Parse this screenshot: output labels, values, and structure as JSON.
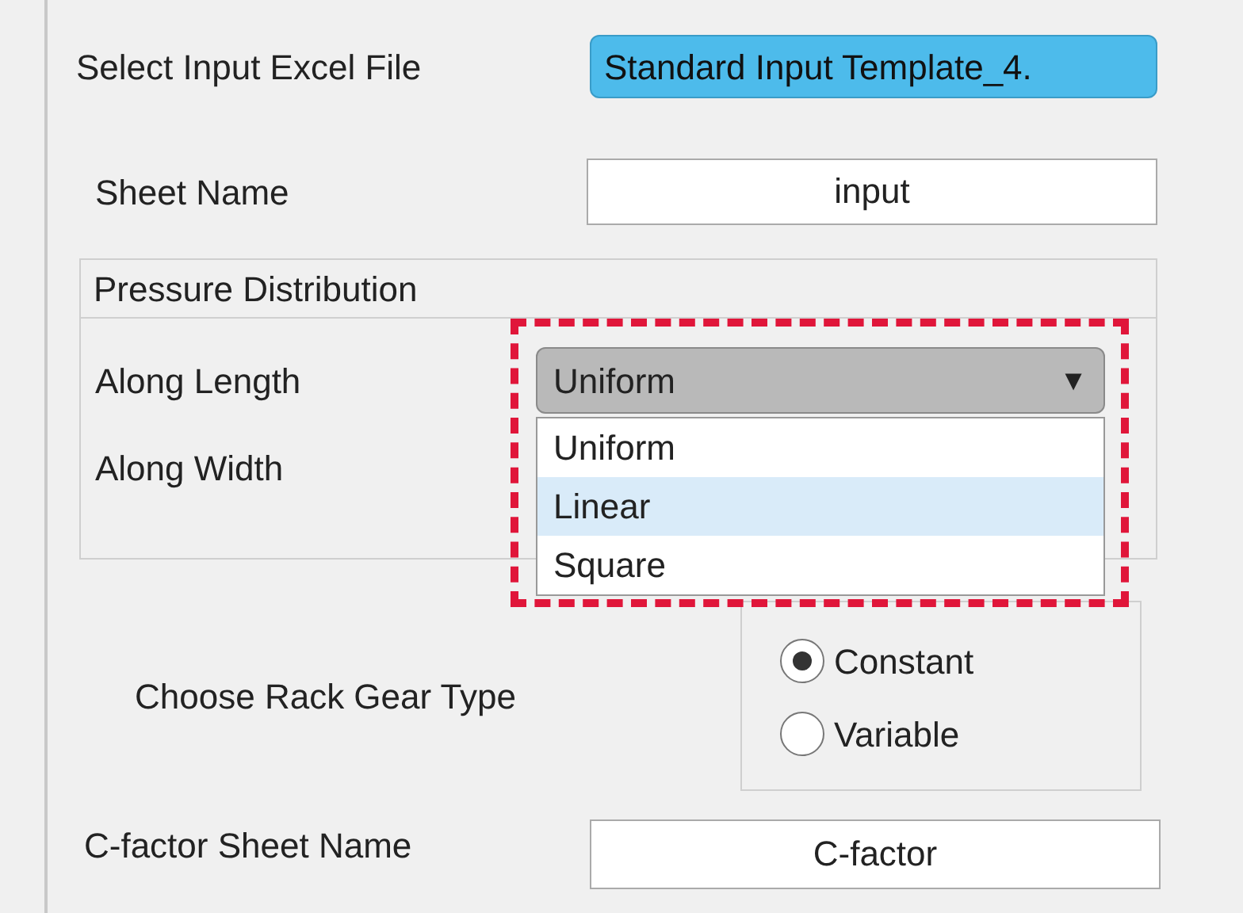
{
  "file_select": {
    "label": "Select Input Excel File",
    "button": "Standard Input Template_4."
  },
  "sheet": {
    "label": "Sheet Name",
    "value": "input"
  },
  "pressure_panel": {
    "title": "Pressure Distribution",
    "along_length": {
      "label": "Along Length",
      "value": "Uniform",
      "caret": "▼",
      "expanded": true,
      "highlighted": true,
      "options": [
        {
          "label": "Uniform",
          "highlighted": false
        },
        {
          "label": "Linear",
          "highlighted": true
        },
        {
          "label": "Square",
          "highlighted": false
        }
      ]
    },
    "along_width": {
      "label": "Along Width"
    }
  },
  "rack_gear": {
    "label": "Choose Rack Gear Type",
    "options": [
      {
        "label": "Constant",
        "selected": true
      },
      {
        "label": "Variable",
        "selected": false
      }
    ]
  },
  "cfactor": {
    "label": "C-factor Sheet Name",
    "value": "C-factor"
  }
}
